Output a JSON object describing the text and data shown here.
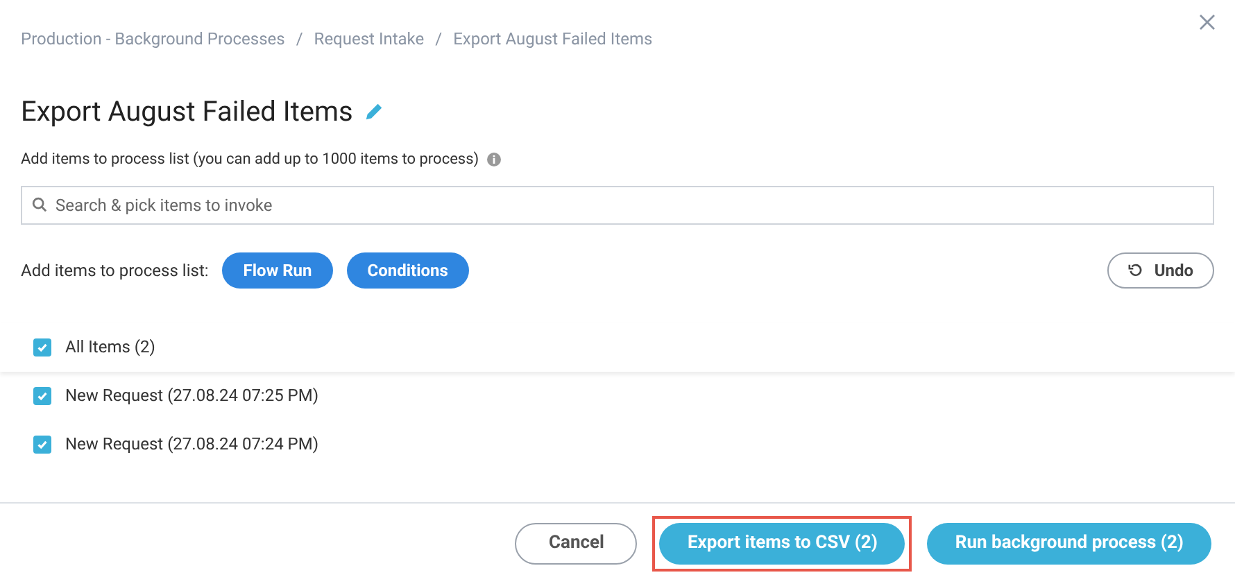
{
  "breadcrumb": [
    "Production - Background Processes",
    "Request Intake",
    "Export August Failed Items"
  ],
  "breadcrumb_separator": "/",
  "title": "Export August Failed Items",
  "instructions": "Add items to process list (you can add up to 1000 items to process)",
  "search": {
    "placeholder": "Search & pick items to invoke"
  },
  "add_row": {
    "label": "Add items to process list:",
    "buttons": [
      "Flow Run",
      "Conditions"
    ],
    "undo": "Undo"
  },
  "all_items": {
    "label": "All Items (2)",
    "checked": true
  },
  "items": [
    {
      "label": "New Request (27.08.24 07:25 PM)",
      "checked": true
    },
    {
      "label": "New Request (27.08.24 07:24 PM)",
      "checked": true
    }
  ],
  "footer": [
    {
      "label": "Cancel",
      "kind": "secondary",
      "highlighted": false
    },
    {
      "label": "Export items to CSV (2)",
      "kind": "primary",
      "highlighted": true
    },
    {
      "label": "Run background process (2)",
      "kind": "primary",
      "highlighted": false
    }
  ]
}
